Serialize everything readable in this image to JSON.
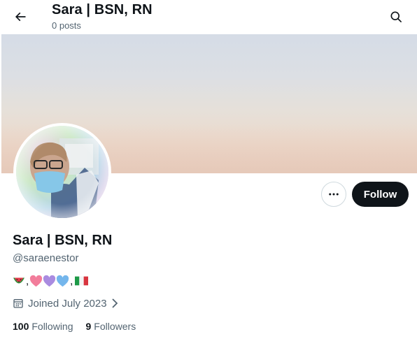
{
  "header": {
    "title": "Sara | BSN, RN",
    "posts_count": "0 posts",
    "back_icon": "arrow-left-icon",
    "search_icon": "search-icon"
  },
  "profile": {
    "name": "Sara | BSN, RN",
    "handle": "@saraenestor",
    "bio_emojis": [
      "watermelon",
      "pink-heart",
      "purple-heart",
      "light-blue-heart",
      "italy-flag"
    ],
    "bio_separator": ",",
    "joined": "Joined July 2023",
    "following_count": "100",
    "following_label": "Following",
    "followers_count": "9",
    "followers_label": "Followers"
  },
  "actions": {
    "follow_label": "Follow",
    "more_icon": "more-horizontal-icon"
  },
  "colors": {
    "text_primary": "#0f1419",
    "text_secondary": "#536471",
    "follow_button_bg": "#0f1419",
    "border": "#cfd9de"
  }
}
